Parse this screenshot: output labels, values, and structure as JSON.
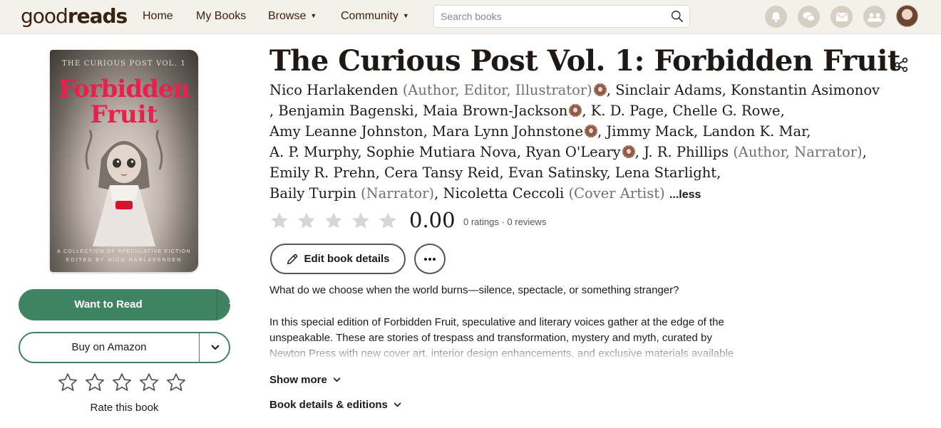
{
  "header": {
    "logo_light": "good",
    "logo_bold": "reads",
    "nav": [
      {
        "label": "Home",
        "has_dropdown": false
      },
      {
        "label": "My Books",
        "has_dropdown": false
      },
      {
        "label": "Browse",
        "has_dropdown": true
      },
      {
        "label": "Community",
        "has_dropdown": true
      }
    ],
    "search_placeholder": "Search books",
    "icons": [
      "notifications-bell-icon",
      "discussions-icon",
      "messages-icon",
      "friends-icon"
    ],
    "colors": {
      "bar": "#f4f1ea",
      "icon_bg": "#d6d0c4",
      "brand": "#382110"
    }
  },
  "cover": {
    "series_text": "THE CURIOUS POST VOL. 1",
    "title_line1": "Forbidden",
    "title_line2": "Fruit",
    "subtitle": "A COLLECTION OF SPECULATIVE FICTION",
    "editor": "EDITED BY NICO HARLAKENDEN",
    "title_color": "#e8214c"
  },
  "actions": {
    "want_to_read": "Want to Read",
    "buy": "Buy on Amazon",
    "rate": "Rate this book",
    "rate_stars": 5,
    "primary_color": "#3f8363"
  },
  "book": {
    "title": "The Curious Post Vol. 1: Forbidden Fruit",
    "contributors": [
      [
        {
          "name": "Nico Harlakenden",
          "role": "(Author, Editor, Illustrator)",
          "badge": true,
          "sep": ","
        },
        {
          "name": "Sinclair Adams",
          "role": "",
          "badge": false,
          "sep": ","
        },
        {
          "name": "Konstantin Asimonov",
          "role": "",
          "badge": false,
          "sep": ""
        }
      ],
      [
        {
          "name": ", Benjamin Bagenski",
          "role": "",
          "badge": false,
          "sep": ","
        },
        {
          "name": "Maia Brown-Jackson",
          "role": "",
          "badge": true,
          "sep": ","
        },
        {
          "name": "K. D. Page",
          "role": "",
          "badge": false,
          "sep": ","
        },
        {
          "name": "Chelle G. Rowe",
          "role": "",
          "badge": false,
          "sep": ","
        }
      ],
      [
        {
          "name": "Amy Leanne Johnston",
          "role": "",
          "badge": false,
          "sep": ","
        },
        {
          "name": "Mara Lynn Johnstone",
          "role": "",
          "badge": true,
          "sep": ","
        },
        {
          "name": "Jimmy Mack",
          "role": "",
          "badge": false,
          "sep": ","
        },
        {
          "name": "Landon K. Mar",
          "role": "",
          "badge": false,
          "sep": ","
        }
      ],
      [
        {
          "name": "A. P. Murphy",
          "role": "",
          "badge": false,
          "sep": ","
        },
        {
          "name": "Sophie Mutiara Nova",
          "role": "",
          "badge": false,
          "sep": ","
        },
        {
          "name": "Ryan O'Leary",
          "role": "",
          "badge": true,
          "sep": ","
        },
        {
          "name": "J. R. Phillips",
          "role": "(Author, Narrator)",
          "badge": false,
          "sep": ","
        }
      ],
      [
        {
          "name": "Emily R. Prehn",
          "role": "",
          "badge": false,
          "sep": ","
        },
        {
          "name": "Cera Tansy Reid",
          "role": "",
          "badge": false,
          "sep": ","
        },
        {
          "name": "Evan Satinsky",
          "role": "",
          "badge": false,
          "sep": ","
        },
        {
          "name": "Lena Starlight",
          "role": "",
          "badge": false,
          "sep": ","
        }
      ],
      [
        {
          "name": "Baily Turpin",
          "role": "(Narrator)",
          "badge": false,
          "sep": ","
        },
        {
          "name": "Nicoletta Ceccoli",
          "role": "(Cover Artist)",
          "badge": false,
          "sep": ""
        }
      ]
    ],
    "less_link": "...less",
    "rating_value": "0.00",
    "rating_meta": "0 ratings · 0 reviews",
    "rating_stars": 5,
    "edit_button": "Edit book details",
    "description_lead": "What do we choose when the world burns—silence, spectacle, or something stranger?",
    "description_lines": [
      "In this special edition of Forbidden Fruit, speculative and literary voices gather at the edge of the",
      "unspeakable. These are stories of trespass and transformation, mystery and myth, curated by",
      "Newton Press with new cover art, interior design enhancements, and exclusive materials available"
    ],
    "show_more": "Show more",
    "details_link": "Book details & editions"
  }
}
